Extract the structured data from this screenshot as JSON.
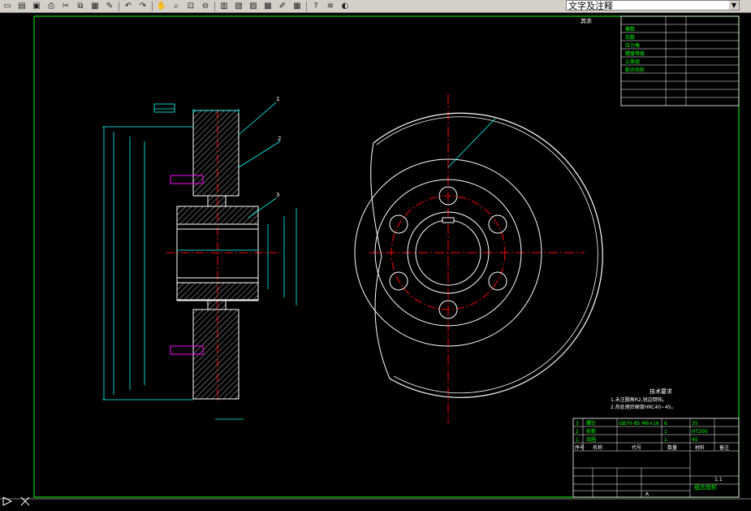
{
  "toolbar": {
    "icons": [
      "new-icon",
      "open-icon",
      "save-icon",
      "plot-icon",
      "cut-icon",
      "copy-icon",
      "paste-icon",
      "match-properties-icon",
      "undo-icon",
      "redo-icon",
      "pan-icon",
      "zoom-realtime-icon",
      "zoom-window-icon",
      "zoom-previous-icon",
      "properties-icon",
      "design-center-icon",
      "tool-palettes-icon",
      "sheet-set-icon",
      "markup-icon",
      "calculator-icon",
      "help-icon",
      "layer-manager-icon",
      "layer-state-icons"
    ],
    "layer_name": "文字及注释"
  },
  "colors": {
    "background": "#000000",
    "border": "#00ff00",
    "outline": "#ffffff",
    "center_line": "#ff0000",
    "dimension": "#00ffff",
    "hatch": "#ffffff",
    "bolt": "#ff00ff"
  },
  "drawing": {
    "leader_labels": [
      "1",
      "2",
      "3"
    ],
    "roughness_note": "其余",
    "tech_title": "技术要求",
    "tech_lines": [
      "1.未注圆角R2,锐边倒钝。",
      "2.热处理后硬度HRC40~45。"
    ],
    "param_rows": [
      "模数",
      "齿数",
      "压力角",
      "精度等级",
      "公差组",
      "配对齿轮"
    ],
    "bom_rows": [
      [
        "3",
        "螺钉",
        "GB70-85 M6×16",
        "6",
        "35"
      ],
      [
        "2",
        "轮毂",
        "",
        "1",
        "HT200"
      ],
      [
        "1",
        "齿圈",
        "",
        "1",
        "45"
      ]
    ],
    "bom_headers": [
      "序号",
      "名称",
      "代号",
      "数量",
      "材料",
      "备注"
    ],
    "title_block_name": "组合齿轮",
    "title_block_scale": "1:1",
    "sheet_label": "A"
  }
}
